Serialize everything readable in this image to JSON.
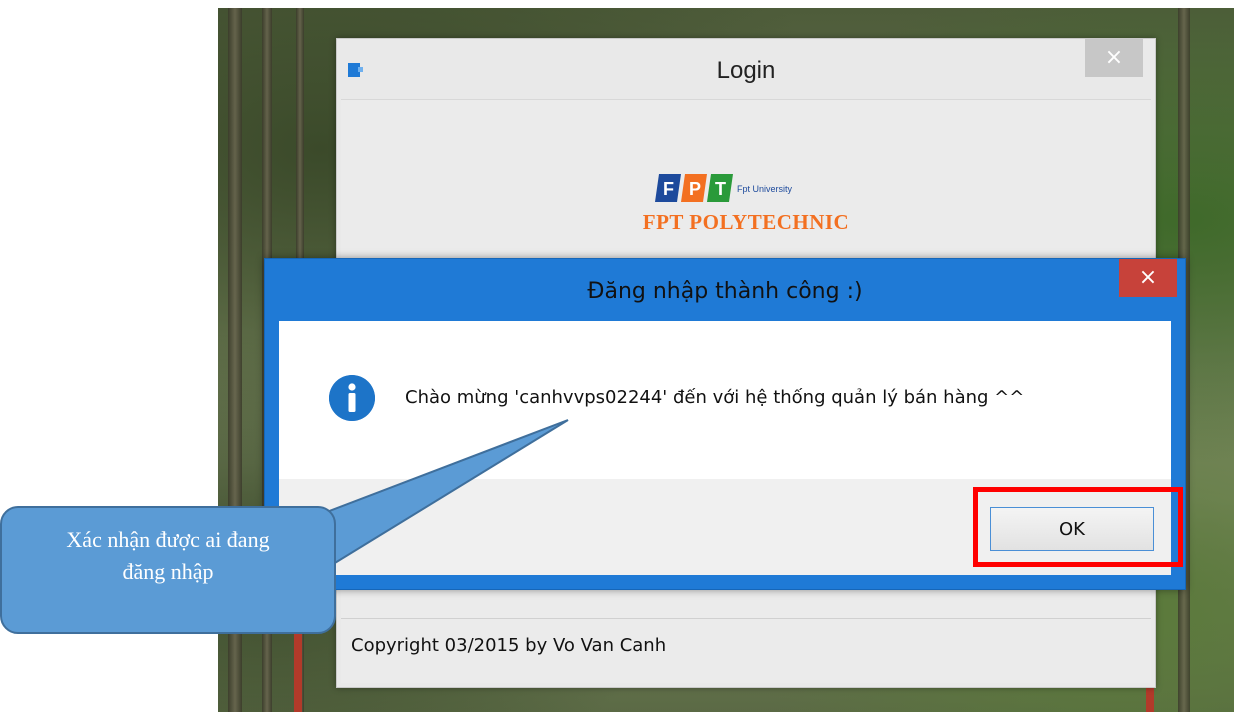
{
  "login_window": {
    "title": "Login",
    "close_label": "×",
    "logo_sub": "Fpt University",
    "logo_name": "FPT POLYTECHNIC",
    "copyright": "Copyright 03/2015 by Vo Van Canh"
  },
  "message_dialog": {
    "title": "Đăng nhập thành công :)",
    "close_label": "×",
    "message": "Chào mừng 'canhvvps02244' đến với hệ thống quản lý bán hàng ^^",
    "ok_label": "OK",
    "icon": "info-icon"
  },
  "callout": {
    "line1": "Xác nhận được ai đang",
    "line2": "đăng nhập"
  },
  "colors": {
    "dialog_frame": "#1f7ad6",
    "highlight": "#ff0000",
    "callout_fill": "#5b9bd5",
    "logo_orange": "#f37021"
  }
}
